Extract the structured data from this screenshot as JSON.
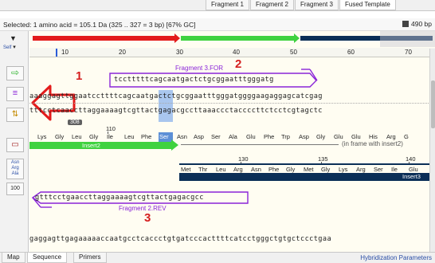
{
  "fragment_tabs": [
    "Fragment 1",
    "Fragment 2",
    "Fragment 3",
    "Fused Template"
  ],
  "status": {
    "selection_text": "Selected:  1 amino acid  =  105.1 Da  (325 .. 327  =  3 bp)     [67% GC]",
    "length_text": "490 bp"
  },
  "ruler": {
    "ticks": [
      "10",
      "20",
      "30",
      "40",
      "50",
      "60",
      "70"
    ]
  },
  "annotations": {
    "fragment3_for_label": "Fragment 3.FOR",
    "fragment2_rev_label": "Fragment 2.REV",
    "num1": "1",
    "num2": "2",
    "num3": "3"
  },
  "sequences": {
    "primer_top": "tcctttttcagcaatgactctgcggaatttgggatg",
    "top_strand": "aaaggagttggaatccttttcagcaatgactctgcggaatttgggatggggaagaggagcatcgag",
    "bottom_strand": "tttcctcaaccttaggaaaagtcgttactgagacgccttaaaccctaccccttctcctcgtagctc",
    "primer_rev": "gtttcctgaaccttaggaaaagtcgttactgagacgcc",
    "bottom_row": "gaggagttgagaaaaaccaatgcctcaccctgtgatcccacttttcatcctgggctgtgctccctgaa"
  },
  "position_markers": {
    "tag_308": "308",
    "num_110": "110",
    "num_130": "130",
    "num_135": "135",
    "num_140": "140"
  },
  "translation_insert2": {
    "residues": [
      "Lys",
      "Gly",
      "Leu",
      "Gly",
      "Ile",
      "Leu",
      "Phe",
      "Ser"
    ],
    "label": "Insert2"
  },
  "translation_right": [
    "Asn",
    "Asp",
    "Ser",
    "Ala",
    "Glu",
    "Phe",
    "Trp",
    "Asp",
    "Gly",
    "Glu",
    "Glu",
    "His",
    "Arg",
    "G"
  ],
  "in_frame_text": "(in frame with insert2)",
  "translation_insert3": {
    "residues": [
      "Met",
      "Thr",
      "Leu",
      "Arg",
      "Asn",
      "Phe",
      "Gly",
      "Met",
      "Gly",
      "Lys",
      "Arg",
      "Ser",
      "Ile",
      "Glu"
    ],
    "label": "Insert3"
  },
  "toolbar": {
    "aa_label_top": "Asn",
    "aa_label_mid": "Arg",
    "aa_label_bot": "Ala",
    "num_label": "100",
    "self_label": "Self"
  },
  "bottom_tabs": [
    "Map",
    "Sequence",
    "Primers"
  ],
  "hybridization_link": "Hybridization Parameters",
  "colors": {
    "red_feature": "#e31b1b",
    "green_feature": "#3fd23f",
    "navy_feature": "#0b2f57",
    "annotation_red": "#d51e1e",
    "primer_purple": "#8a24d8",
    "selection_blue": "#a9c6ee"
  }
}
